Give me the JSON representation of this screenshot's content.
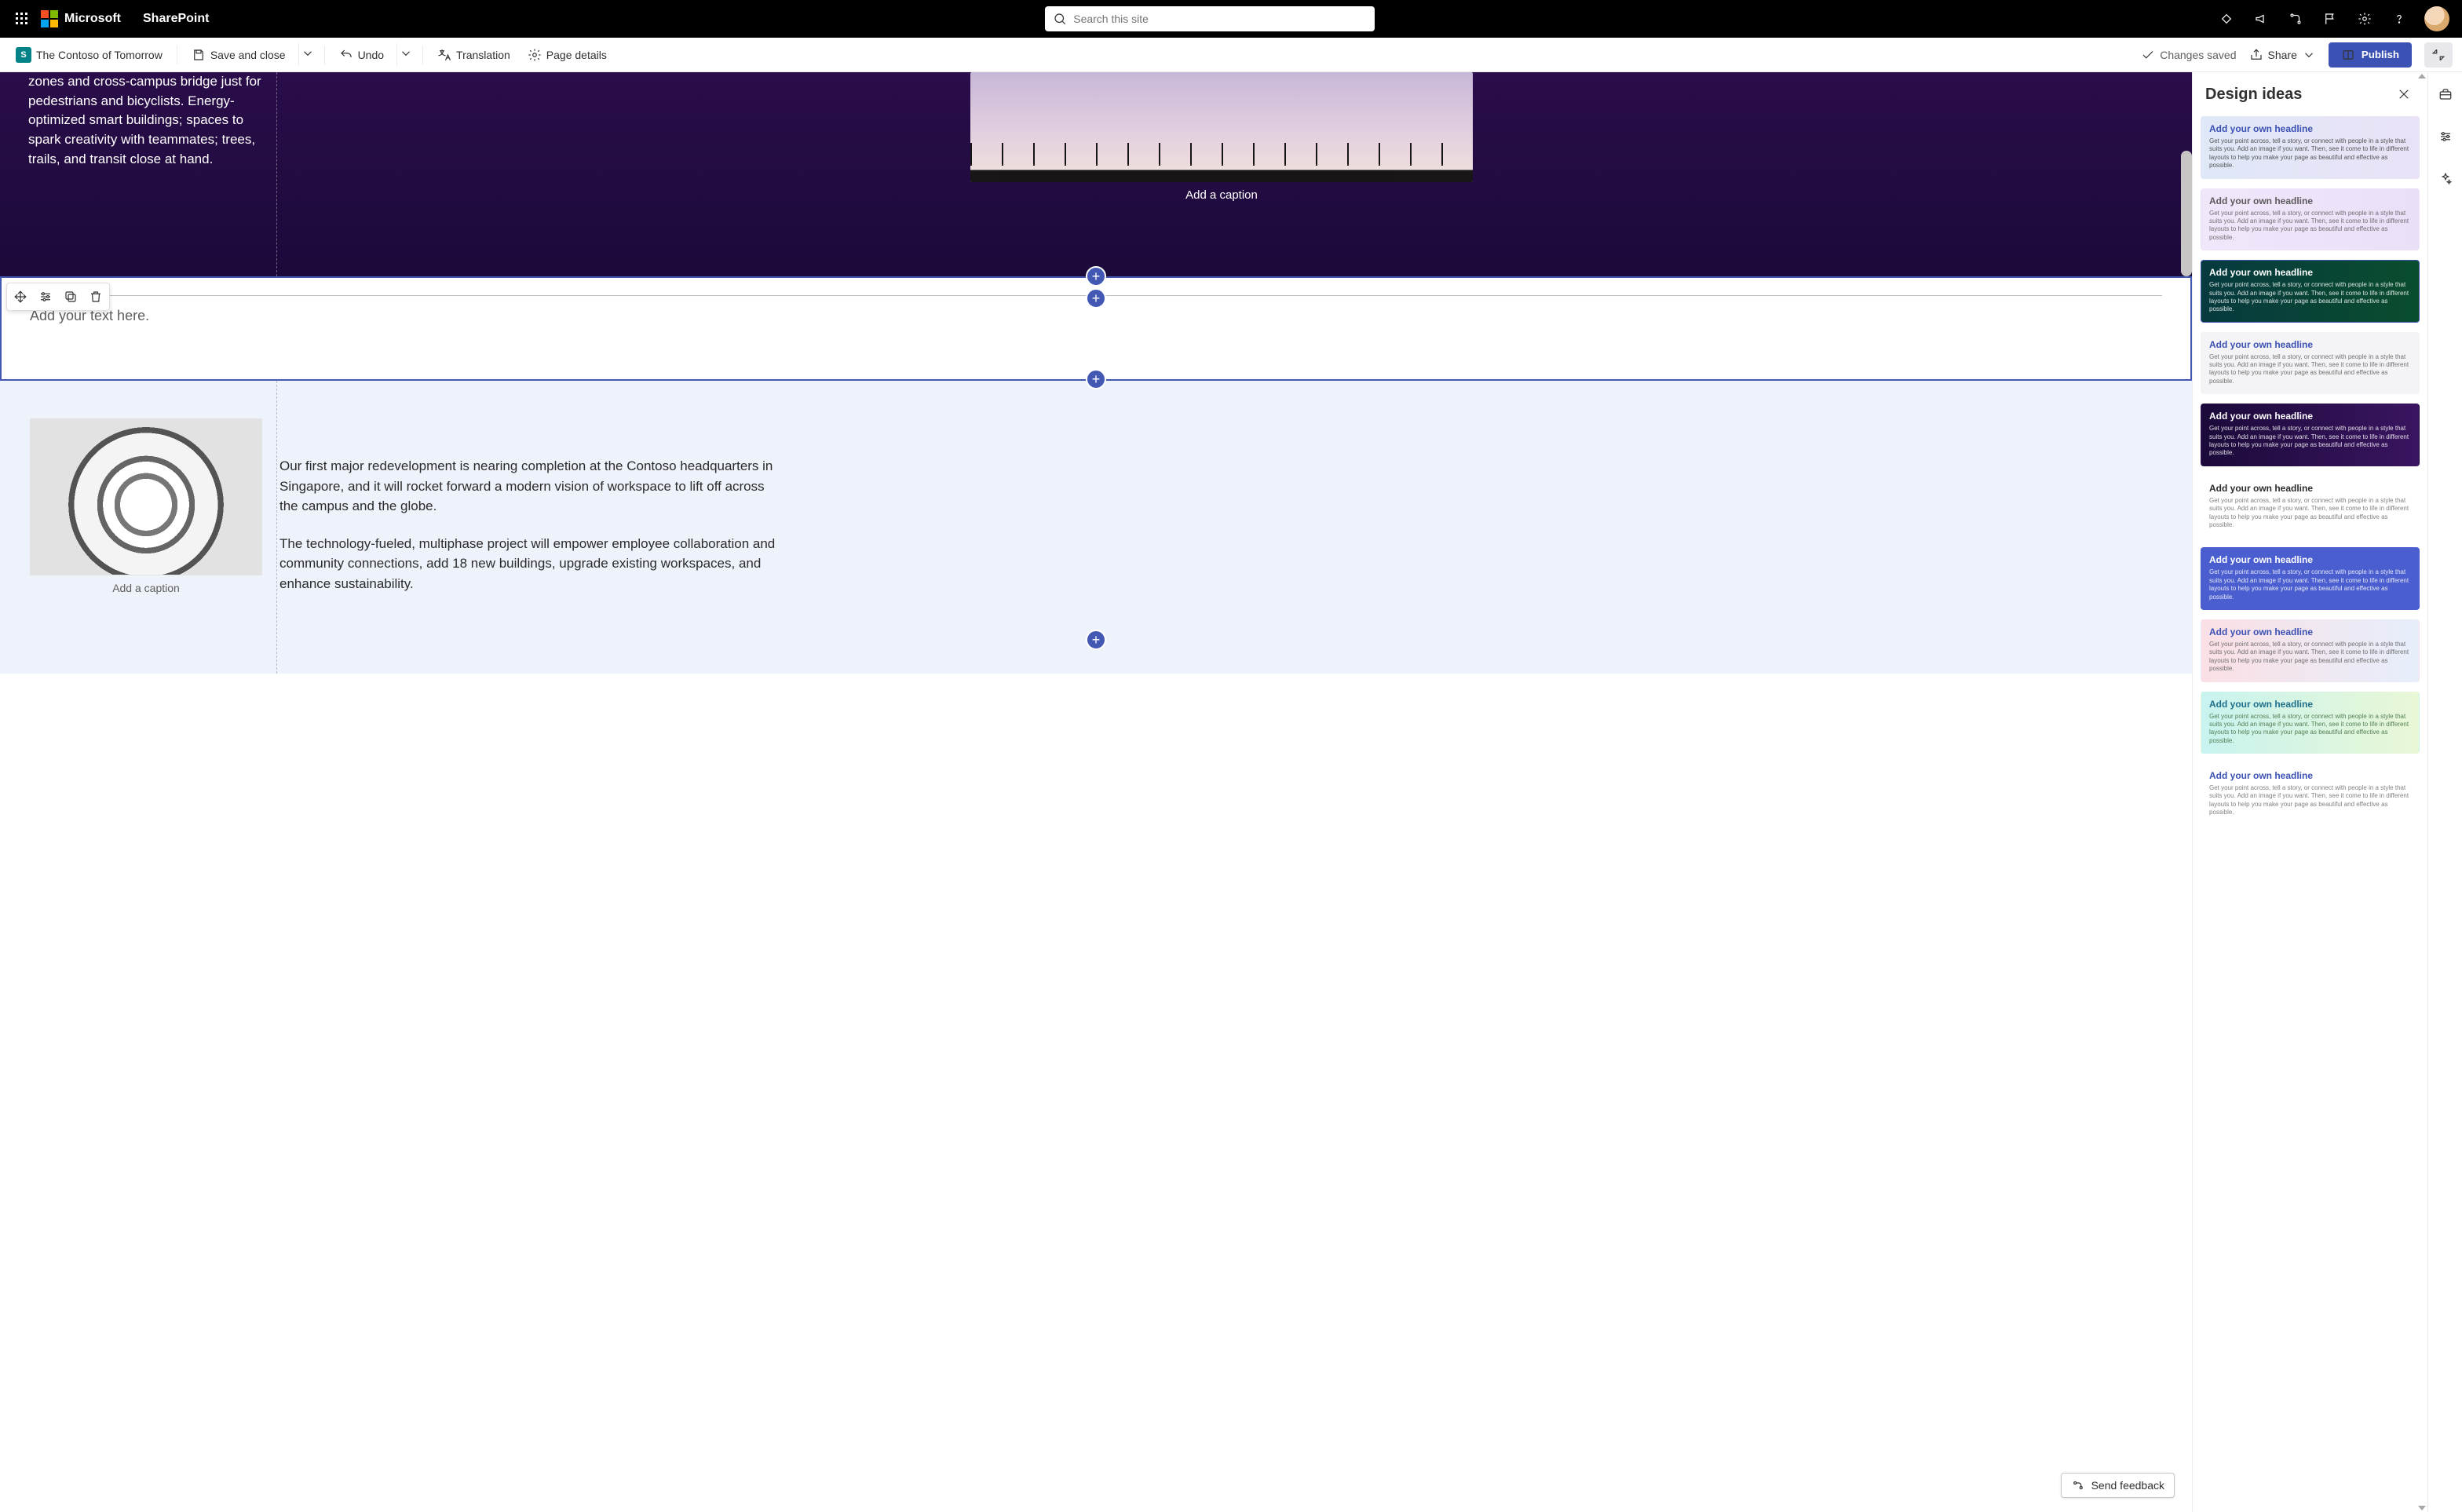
{
  "suite": {
    "brand": "Microsoft",
    "product": "SharePoint",
    "search_placeholder": "Search this site"
  },
  "cmd": {
    "site_name": "The Contoso of Tomorrow",
    "save_close": "Save and close",
    "undo": "Undo",
    "translation": "Translation",
    "page_details": "Page details",
    "saved": "Changes saved",
    "share": "Share",
    "publish": "Publish"
  },
  "hero": {
    "body": "zones and cross-campus bridge just for pedestrians and bicyclists. Energy-optimized smart buildings; spaces to spark creativity with teammates; trees, trails, and transit close at hand.",
    "caption": "Add a caption"
  },
  "text_section": {
    "placeholder": "Add your text here."
  },
  "light": {
    "caption": "Add a caption",
    "p1": "Our first major redevelopment is nearing completion at the Contoso headquarters in Singapore, and it will rocket forward a modern vision of workspace to lift off across the campus and the globe.",
    "p2": "The technology-fueled, multiphase project will empower employee collaboration and community connections, add 18 new buildings, upgrade existing workspaces, and enhance sustainability."
  },
  "feedback": {
    "label": "Send feedback"
  },
  "panel": {
    "title": "Design ideas",
    "idea_headline": "Add your own headline",
    "idea_body": "Get your point across, tell a story, or connect with people in a style that suits you. Add an image if you want. Then, see it come to life in different layouts to help you make your page as beautiful and effective as possible.",
    "ideas": [
      {
        "bg": "linear-gradient(90deg,#dfe8f7,#e9e2f6)",
        "fg": "#3b51b3",
        "tc": "#3b3b3b"
      },
      {
        "bg": "linear-gradient(90deg,#f1e7fb,#e9e0f8)",
        "fg": "#5b5b5b",
        "tc": "#5b5b5b"
      },
      {
        "bg": "linear-gradient(90deg,#063a3f,#0a4d2e)",
        "fg": "#ffffff",
        "tc": "#ffffff",
        "sel": true
      },
      {
        "bg": "#f4f4f6",
        "fg": "#3b51b3",
        "tc": "#5b5b5b"
      },
      {
        "bg": "linear-gradient(90deg,#1b0a3a,#3a1560)",
        "fg": "#ffffff",
        "tc": "#ffffff"
      },
      {
        "bg": "#ffffff",
        "fg": "#2b2b2b",
        "tc": "#6b6b6b"
      },
      {
        "bg": "#4a5ecf",
        "fg": "#ffffff",
        "tc": "#ffffff"
      },
      {
        "bg": "linear-gradient(90deg,#fbe0e5,#e6eefb)",
        "fg": "#3b51b3",
        "tc": "#5b5b5b"
      },
      {
        "bg": "linear-gradient(90deg,#c8f3ef,#e9f7d6)",
        "fg": "#1f6f8b",
        "tc": "#3b6b3b"
      },
      {
        "bg": "#ffffff",
        "fg": "#3b51b3",
        "tc": "#6b6b6b"
      }
    ]
  }
}
